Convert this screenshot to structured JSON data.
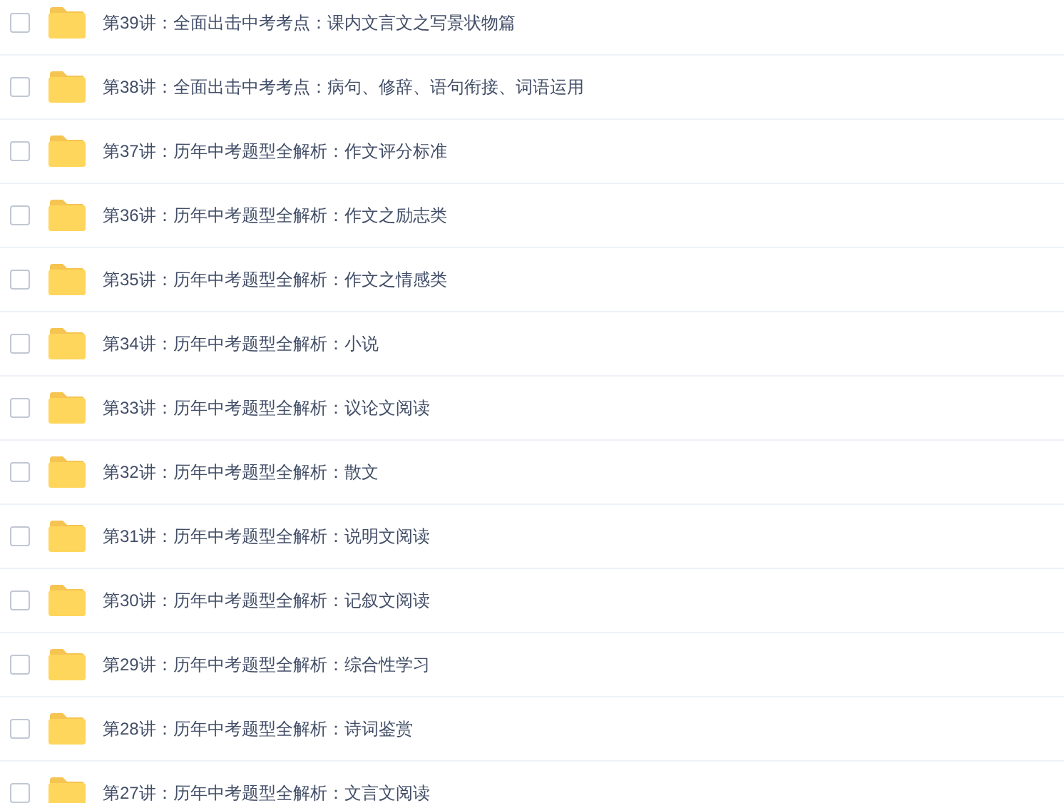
{
  "files": [
    {
      "name": "第39讲：全面出击中考考点：课内文言文之写景状物篇",
      "checked": false
    },
    {
      "name": "第38讲：全面出击中考考点：病句、修辞、语句衔接、词语运用",
      "checked": false
    },
    {
      "name": "第37讲：历年中考题型全解析：作文评分标准",
      "checked": false
    },
    {
      "name": "第36讲：历年中考题型全解析：作文之励志类",
      "checked": false
    },
    {
      "name": "第35讲：历年中考题型全解析：作文之情感类",
      "checked": false
    },
    {
      "name": "第34讲：历年中考题型全解析：小说",
      "checked": false
    },
    {
      "name": "第33讲：历年中考题型全解析：议论文阅读",
      "checked": false
    },
    {
      "name": "第32讲：历年中考题型全解析：散文",
      "checked": false
    },
    {
      "name": "第31讲：历年中考题型全解析：说明文阅读",
      "checked": false
    },
    {
      "name": "第30讲：历年中考题型全解析：记叙文阅读",
      "checked": false
    },
    {
      "name": "第29讲：历年中考题型全解析：综合性学习",
      "checked": false
    },
    {
      "name": "第28讲：历年中考题型全解析：诗词鉴赏",
      "checked": false
    },
    {
      "name": "第27讲：历年中考题型全解析：文言文阅读",
      "checked": false
    }
  ]
}
